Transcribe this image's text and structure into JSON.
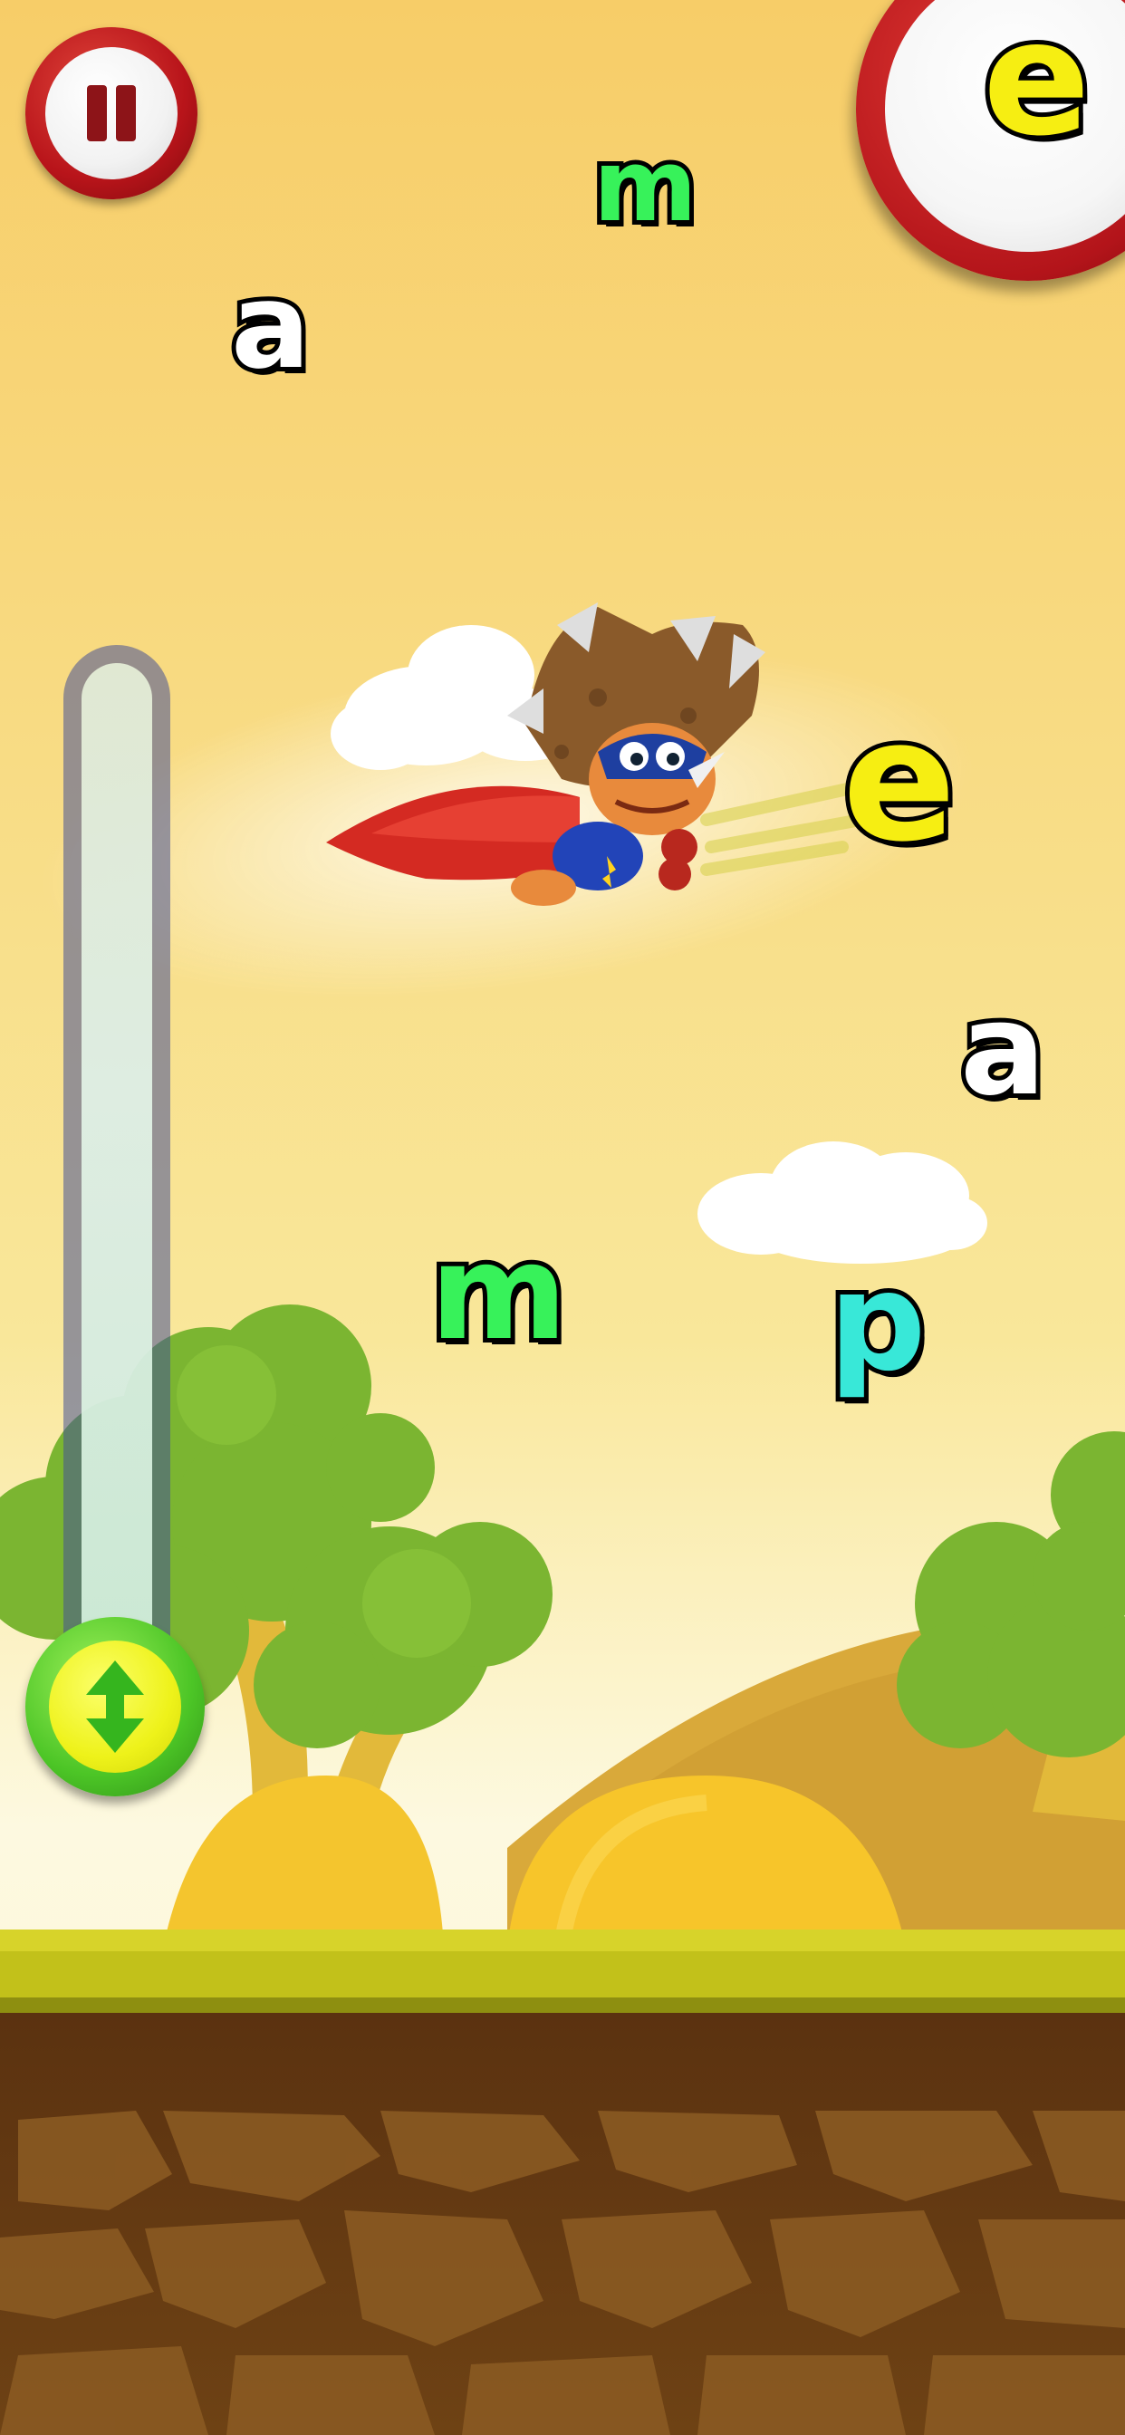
{
  "game": {
    "target_letter": "e",
    "floating_letters": [
      {
        "char": "m",
        "color": "#37f25a"
      },
      {
        "char": "a",
        "color": "#ffffff"
      },
      {
        "char": "e",
        "color": "#f6ee12"
      },
      {
        "char": "a",
        "color": "#ffffff"
      },
      {
        "char": "m",
        "color": "#37f25a"
      },
      {
        "char": "p",
        "color": "#38e8d8"
      }
    ],
    "character": "flying-triceratops-superhero",
    "height_meter_level": 0.0
  },
  "controls": {
    "pause_icon": "pause-icon",
    "meter_icon": "up-down-arrows-icon"
  },
  "colors": {
    "sky_top": "#f6cf6a",
    "sky_bottom": "#fbf4c4",
    "grass": "#c8c81a",
    "ground": "#6b3d12",
    "pause_red": "#c01820",
    "knob_green": "#4cc526",
    "knob_yellow": "#eef21a"
  }
}
